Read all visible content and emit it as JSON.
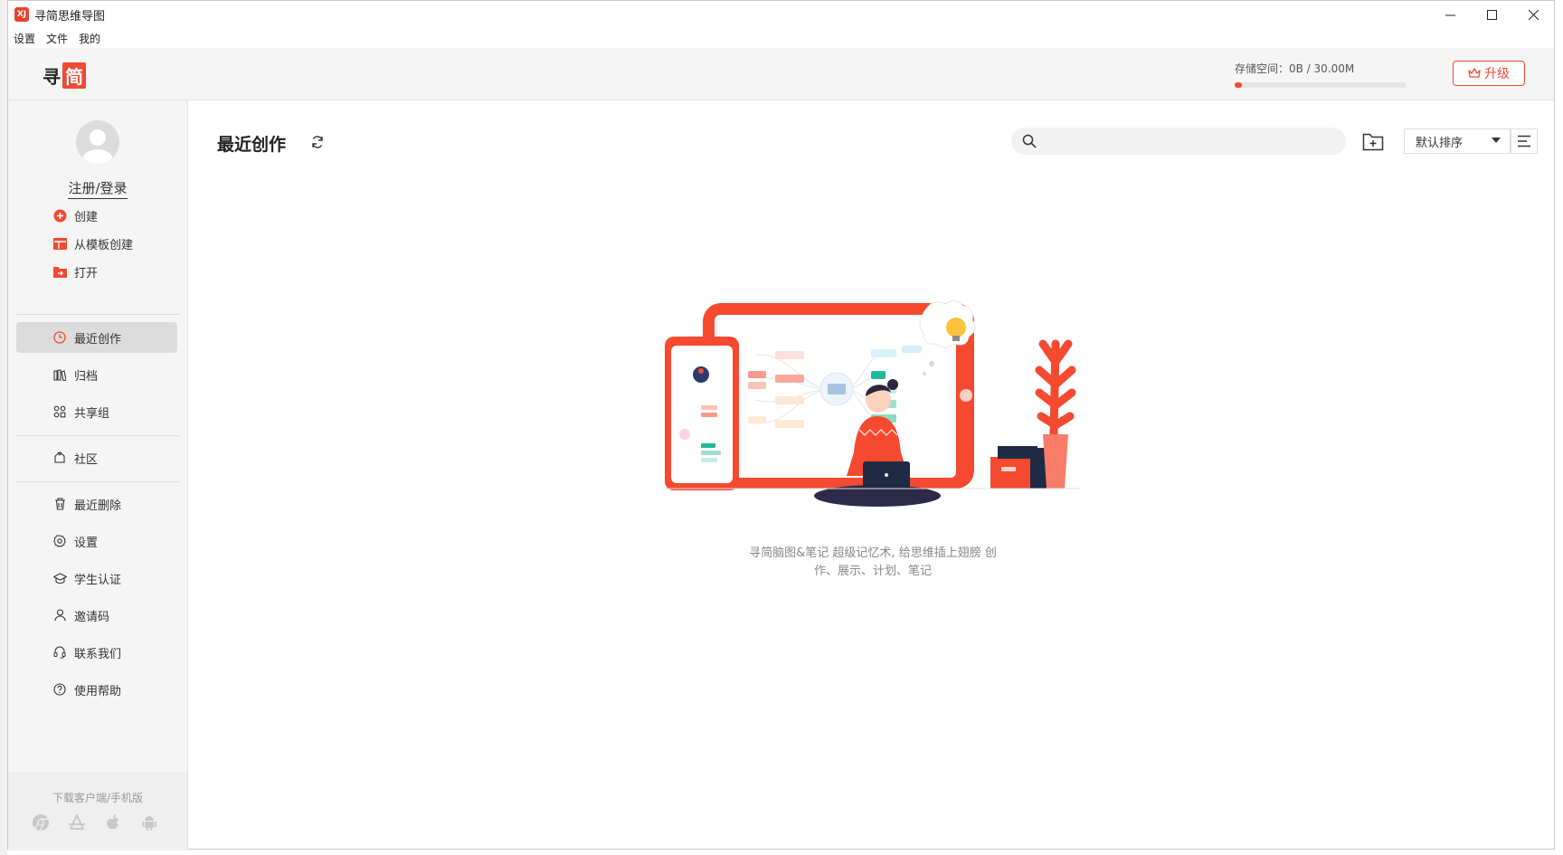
{
  "window": {
    "title": "寻简思维导图"
  },
  "menu": [
    "设置",
    "文件",
    "我的"
  ],
  "header": {
    "logo_part1": "寻",
    "logo_part2": "简",
    "storage_label": "存储空间：0B / 30.00M",
    "storage_fraction": 0.0,
    "upgrade_label": "升级"
  },
  "sidebar": {
    "login_label": "注册/登录",
    "actions": [
      {
        "label": "创建",
        "icon": "plus-circle-icon"
      },
      {
        "label": "从模板创建",
        "icon": "template-icon"
      },
      {
        "label": "打开",
        "icon": "open-folder-icon"
      }
    ],
    "nav": [
      {
        "label": "最近创作",
        "icon": "clock-icon",
        "active": true
      },
      {
        "label": "归档",
        "icon": "archive-icon"
      },
      {
        "label": "共享组",
        "icon": "share-group-icon"
      }
    ],
    "community": {
      "label": "社区",
      "icon": "community-icon"
    },
    "bottom": [
      {
        "label": "最近删除",
        "icon": "trash-icon"
      },
      {
        "label": "设置",
        "icon": "gear-icon"
      },
      {
        "label": "学生认证",
        "icon": "graduation-cap-icon"
      },
      {
        "label": "邀请码",
        "icon": "user-icon"
      },
      {
        "label": "联系我们",
        "icon": "headset-icon"
      },
      {
        "label": "使用帮助",
        "icon": "help-icon"
      }
    ],
    "download_label": "下载客户端/手机版",
    "download_icons": [
      "chrome-icon",
      "app-store-icon",
      "apple-icon",
      "android-icon"
    ]
  },
  "main": {
    "title": "最近创作",
    "search_placeholder": "",
    "sort_label": "默认排序",
    "empty_caption_line1": "寻简脑图&笔记 超级记忆术, 给思维插上翅膀 创",
    "empty_caption_line2": "作、展示、计划、笔记"
  },
  "colors": {
    "accent": "#ef4a32",
    "sidebar_bg": "#f5f5f5",
    "active_bg": "#dcdcdc"
  }
}
